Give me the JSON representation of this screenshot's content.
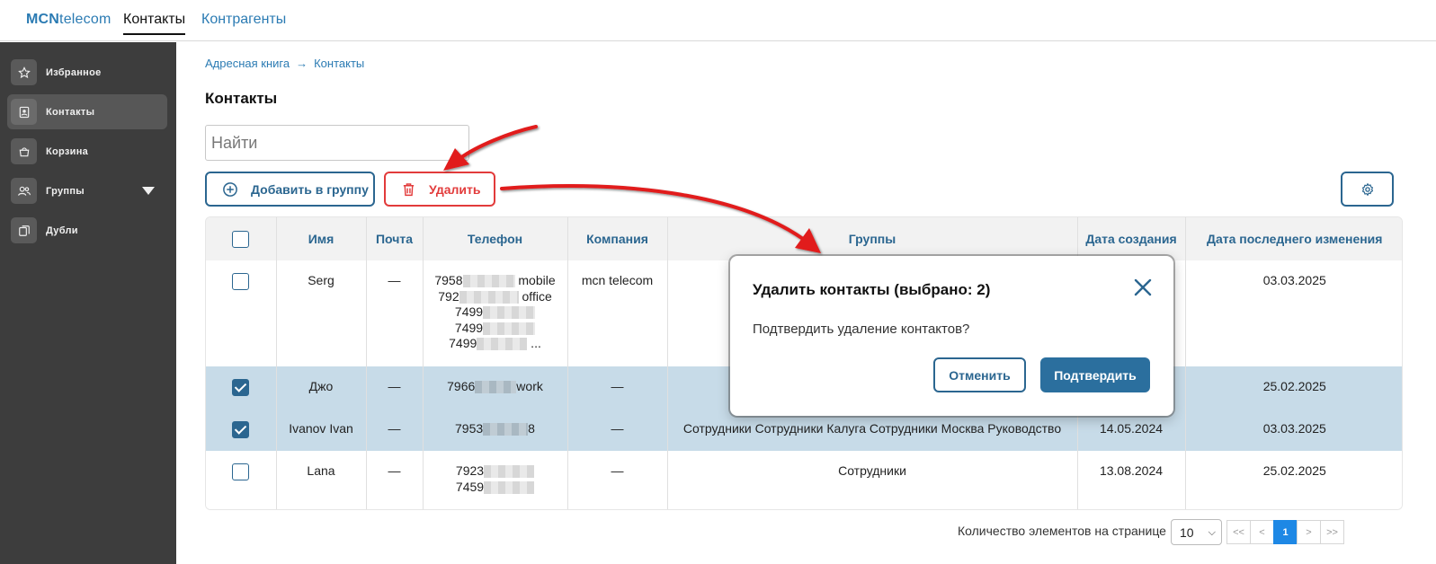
{
  "brand": {
    "bold": "MCN",
    "rest": "telecom"
  },
  "top_nav": {
    "contacts": "Контакты",
    "counterparties": "Контрагенты"
  },
  "sidebar": {
    "items": [
      {
        "label": "Избранное",
        "icon": "star-icon"
      },
      {
        "label": "Контакты",
        "icon": "contact-card-icon"
      },
      {
        "label": "Корзина",
        "icon": "basket-icon"
      },
      {
        "label": "Группы",
        "icon": "users-icon"
      },
      {
        "label": "Дубли",
        "icon": "duplicate-icon"
      }
    ]
  },
  "breadcrumb": {
    "parent": "Адресная книга",
    "separator": "→",
    "current": "Контакты"
  },
  "page_title": "Контакты",
  "search": {
    "placeholder": "Найти",
    "value": ""
  },
  "toolbar": {
    "add_to_group": "Добавить в группу",
    "delete": "Удалить"
  },
  "table": {
    "headers": {
      "name": "Имя",
      "email": "Почта",
      "phone": "Телефон",
      "company": "Компания",
      "groups": "Группы",
      "created": "Дата создания",
      "modified": "Дата последнего изменения"
    },
    "rows": [
      {
        "checked": false,
        "name": "Serg",
        "email": "—",
        "phones": [
          {
            "prefix": "7958",
            "suffix": " mobile"
          },
          {
            "prefix": "792",
            "suffix": " office"
          },
          {
            "prefix": "7499",
            "suffix": ""
          },
          {
            "prefix": "7499",
            "suffix": ""
          },
          {
            "prefix": "7499",
            "suffix": " ..."
          }
        ],
        "company": "mcn telecom",
        "groups": "",
        "created": "",
        "modified": "03.03.2025"
      },
      {
        "checked": true,
        "name": "Джо",
        "email": "—",
        "phones": [
          {
            "prefix": "7966",
            "suffix": "work"
          }
        ],
        "company": "—",
        "groups": "",
        "created": "",
        "modified": "25.02.2025"
      },
      {
        "checked": true,
        "name": "Ivanov Ivan",
        "email": "—",
        "phones": [
          {
            "prefix": "7953",
            "suffix": "8"
          }
        ],
        "company": "—",
        "groups": "Сотрудники Сотрудники Калуга Сотрудники Москва Руководство",
        "created": "14.05.2024",
        "modified": "03.03.2025"
      },
      {
        "checked": false,
        "name": "Lana",
        "email": "—",
        "phones": [
          {
            "prefix": "7923",
            "suffix": ""
          },
          {
            "prefix": "7459",
            "suffix": ""
          }
        ],
        "company": "—",
        "groups": "Сотрудники",
        "created": "13.08.2024",
        "modified": "25.02.2025"
      }
    ]
  },
  "pagination": {
    "label": "Количество элементов на странице",
    "page_size": "10",
    "first": "<<",
    "prev": "<",
    "current": "1",
    "next": ">",
    "last": ">>"
  },
  "modal": {
    "title": "Удалить контакты (выбрано: 2)",
    "text": "Подтвердить удаление контактов?",
    "cancel": "Отменить",
    "confirm": "Подтвердить"
  },
  "colors": {
    "primary": "#2b6690",
    "link": "#2b7bb3",
    "danger": "#e23b3b",
    "sidebar_bg": "#3d3d3d",
    "selected_row": "#c7dbe8",
    "annotation_arrow": "#e11a1a",
    "page_active": "#1e88e5"
  }
}
